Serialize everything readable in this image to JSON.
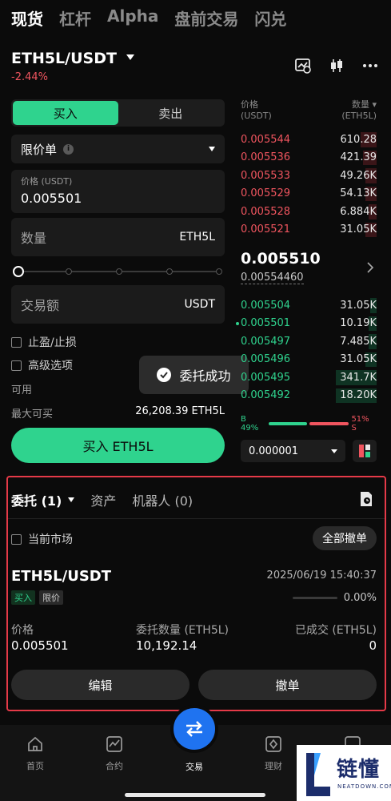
{
  "top_tabs": [
    "现货",
    "杠杆",
    "Alpha",
    "盘前交易",
    "闪兑"
  ],
  "pair": {
    "title": "ETH5L/USDT",
    "change": "-2.44%"
  },
  "header_icons": [
    "chart-settings-icon",
    "candlestick-icon",
    "more-icon"
  ],
  "trade": {
    "buy_label": "买入",
    "sell_label": "卖出",
    "order_type": "限价单",
    "price_label": "价格 (USDT)",
    "price_value": "0.005501",
    "qty_label": "数量",
    "qty_unit": "ETH5L",
    "amount_label": "交易额",
    "amount_unit": "USDT",
    "tpsl_label": "止盈/止损",
    "advanced_label": "高级选项",
    "available_label": "可用",
    "max_buy_label": "最大可买",
    "max_buy_value": "26,208.39 ETH5L",
    "submit_label": "买入 ETH5L"
  },
  "toast": {
    "text": "委托成功"
  },
  "orderbook": {
    "price_header": [
      "价格",
      "(USDT)"
    ],
    "qty_header": [
      "数量",
      "(ETH5L)"
    ],
    "asks": [
      {
        "price": "0.005544",
        "qty": "610.28",
        "depth": 0.12
      },
      {
        "price": "0.005536",
        "qty": "421.39",
        "depth": 0.1
      },
      {
        "price": "0.005533",
        "qty": "49.26K",
        "depth": 0.08
      },
      {
        "price": "0.005529",
        "qty": "54.13K",
        "depth": 0.08
      },
      {
        "price": "0.005528",
        "qty": "6.884K",
        "depth": 0.06
      },
      {
        "price": "0.005521",
        "qty": "31.05K",
        "depth": 0.08
      }
    ],
    "last_price": "0.005510",
    "mark_price": "0.00554460",
    "bids": [
      {
        "price": "0.005504",
        "qty": "31.05K",
        "depth": 0.05,
        "mine": false
      },
      {
        "price": "0.005501",
        "qty": "10.19K",
        "depth": 0.06,
        "mine": true
      },
      {
        "price": "0.005497",
        "qty": "7.485K",
        "depth": 0.06,
        "mine": false
      },
      {
        "price": "0.005496",
        "qty": "31.05K",
        "depth": 0.08,
        "mine": false
      },
      {
        "price": "0.005495",
        "qty": "341.7K",
        "depth": 0.3,
        "mine": false
      },
      {
        "price": "0.005492",
        "qty": "18.20K",
        "depth": 0.3,
        "mine": false
      }
    ],
    "buy_ratio_label": "B 49%",
    "sell_ratio_label": "51% S",
    "buy_ratio": 0.49,
    "precision": "0.000001"
  },
  "orders": {
    "tabs": [
      "委托 (1)",
      "资产",
      "机器人 (0)"
    ],
    "current_market_label": "当前市场",
    "cancel_all_label": "全部撤单",
    "pair": "ETH5L/USDT",
    "time": "2025/06/19 15:40:37",
    "side_tag": "买入",
    "type_tag": "限价",
    "filled_pct": "0.00%",
    "filled_fraction": 0,
    "col_price": "价格",
    "col_qty": "委托数量 (ETH5L)",
    "col_filled": "已成交 (ETH5L)",
    "val_price": "0.005501",
    "val_qty": "10,192.14",
    "val_filled": "0",
    "edit_label": "编辑",
    "cancel_label": "撤单"
  },
  "bottom_nav": {
    "home": "首页",
    "contract": "合约",
    "trade": "交易",
    "finance": "理财"
  },
  "watermark": {
    "text": "链懂",
    "sub": "NEATDOWN.COM"
  },
  "colors": {
    "buy": "#2fd38e",
    "sell": "#f0555f",
    "accent": "#1f73f0",
    "highlight_border": "#e53a48"
  }
}
